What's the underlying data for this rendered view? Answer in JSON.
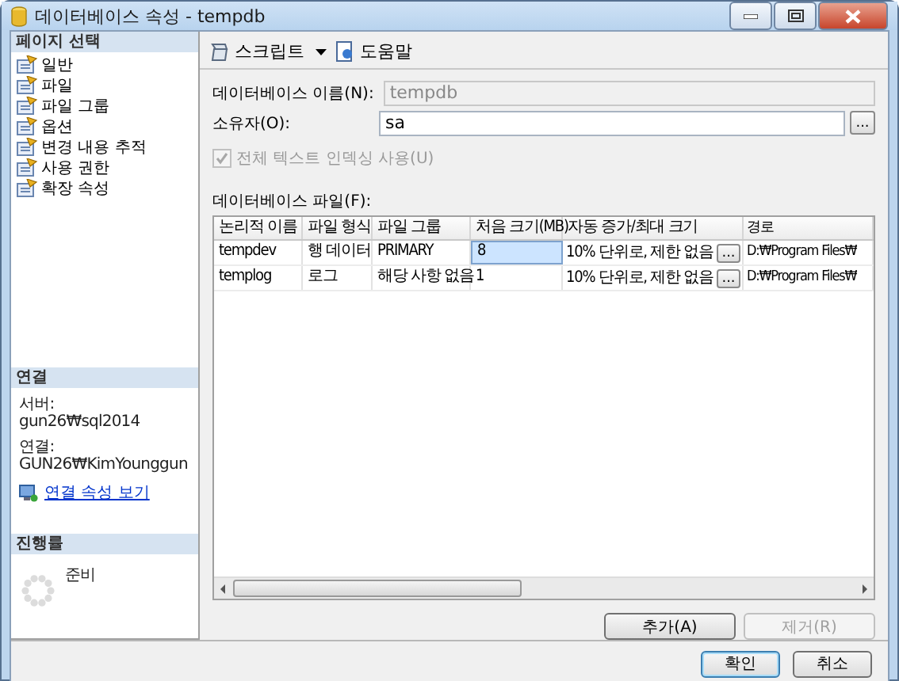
{
  "window": {
    "title": "데이터베이스 속성 - tempdb"
  },
  "sidebar": {
    "header": "페이지 선택",
    "items": [
      {
        "label": "일반"
      },
      {
        "label": "파일"
      },
      {
        "label": "파일 그룹"
      },
      {
        "label": "옵션"
      },
      {
        "label": "변경 내용 추적"
      },
      {
        "label": "사용 권한"
      },
      {
        "label": "확장 속성"
      }
    ],
    "connection": {
      "header": "연결",
      "server_label": "서버:",
      "server": "gun26₩sql2014",
      "connection_label": "연결:",
      "connection": "GUN26₩KimYounggun",
      "link": "연결 속성 보기"
    },
    "progress": {
      "header": "진행률",
      "status": "준비"
    }
  },
  "toolbar": [
    {
      "kind": "dropdown",
      "label": "스크립트"
    },
    {
      "kind": "button",
      "label": "도움말"
    }
  ],
  "form": {
    "name_label": "데이터베이스 이름(N):",
    "name_value": "tempdb",
    "name_disabled": true,
    "owner_label": "소유자(O):",
    "owner_value": "sa",
    "owner_button": "...",
    "fulltext": {
      "label": "전체 텍스트 인덱싱 사용(U)",
      "checked": true,
      "disabled": true
    }
  },
  "files": {
    "label": "데이터베이스 파일(F):",
    "columns": [
      "논리적 이름",
      "파일 형식",
      "파일 그룹",
      "처음 크기(MB)",
      "자동 증가/최대 크기",
      "경로"
    ],
    "rows": [
      {
        "cells": [
          "tempdev",
          "행 데이터",
          "PRIMARY",
          "8",
          "10% 단위로, 제한 없음",
          "D:₩Program Files₩"
        ],
        "button": "...",
        "selected": true
      },
      {
        "cells": [
          "templog",
          "로그",
          "해당 사항 없음",
          "1",
          "10% 단위로, 제한 없음",
          "D:₩Program Files₩"
        ],
        "button": "...",
        "selected": false
      }
    ]
  },
  "file_buttons": [
    {
      "label": "추가(A)",
      "disabled": false
    },
    {
      "label": "제거(R)",
      "disabled": true
    }
  ],
  "dialog_buttons": [
    {
      "label": "확인",
      "default": true
    },
    {
      "label": "취소",
      "default": false
    }
  ]
}
